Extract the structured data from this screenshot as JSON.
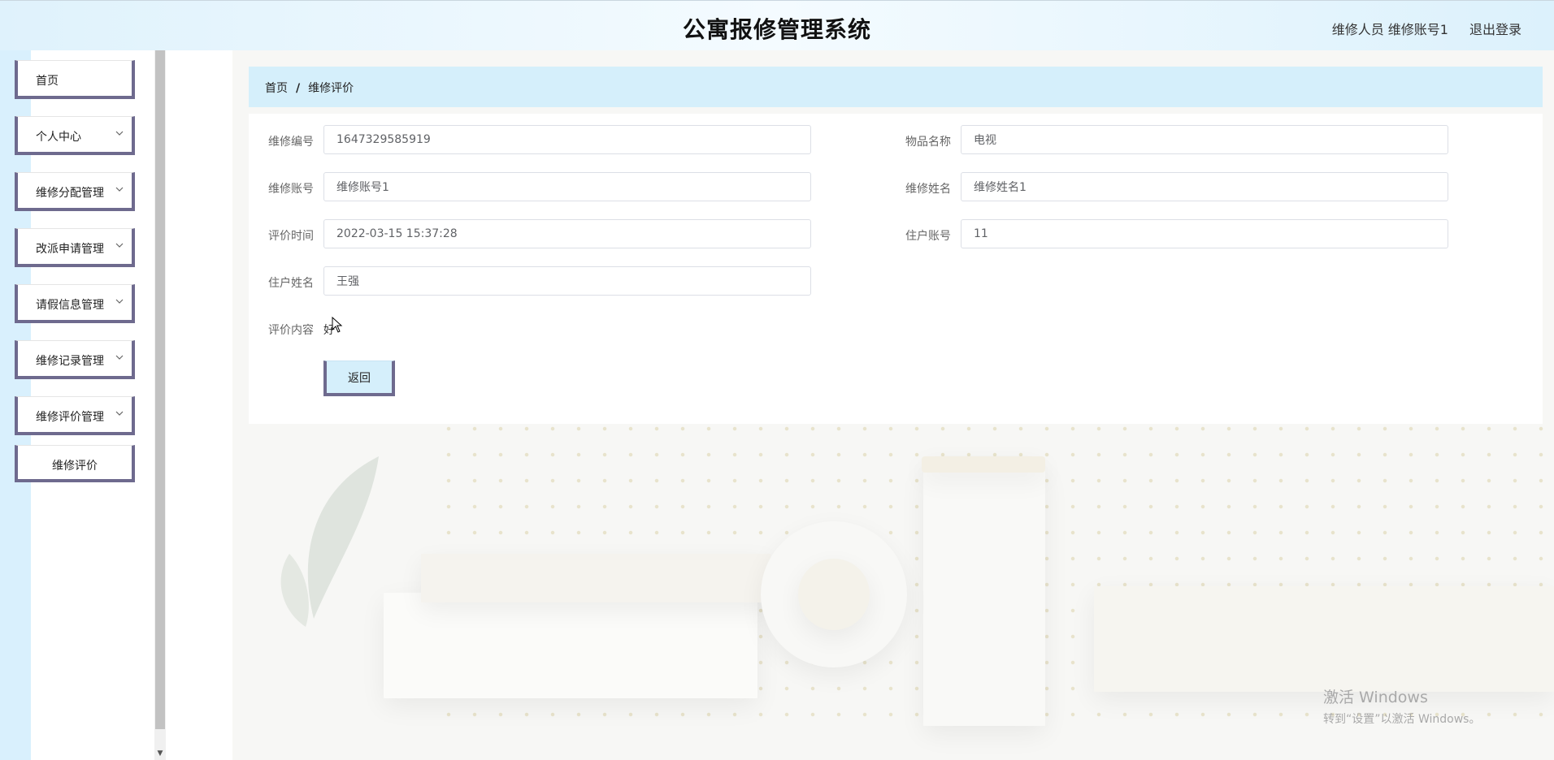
{
  "header": {
    "title": "公寓报修管理系统",
    "user": "维修人员 维修账号1",
    "logout": "退出登录"
  },
  "sidebar": {
    "items": [
      {
        "label": "首页",
        "has_chevron": false
      },
      {
        "label": "个人中心",
        "has_chevron": true
      },
      {
        "label": "维修分配管理",
        "has_chevron": true
      },
      {
        "label": "改派申请管理",
        "has_chevron": true
      },
      {
        "label": "请假信息管理",
        "has_chevron": true
      },
      {
        "label": "维修记录管理",
        "has_chevron": true
      },
      {
        "label": "维修评价管理",
        "has_chevron": true
      }
    ],
    "sub_item": "维修评价"
  },
  "breadcrumb": {
    "home": "首页",
    "separator": "/",
    "current": "维修评价"
  },
  "form": {
    "repair_no": {
      "label": "维修编号",
      "value": "1647329585919"
    },
    "item_name": {
      "label": "物品名称",
      "value": "电视"
    },
    "repair_account": {
      "label": "维修账号",
      "value": "维修账号1"
    },
    "repair_name": {
      "label": "维修姓名",
      "value": "维修姓名1"
    },
    "eval_time": {
      "label": "评价时间",
      "value": "2022-03-15 15:37:28"
    },
    "resident_account": {
      "label": "住户账号",
      "value": "11"
    },
    "resident_name": {
      "label": "住户姓名",
      "value": "王强"
    },
    "eval_content": {
      "label": "评价内容",
      "value": "好"
    }
  },
  "buttons": {
    "back": "返回"
  },
  "watermark": {
    "line1": "激活 Windows",
    "line2": "转到“设置”以激活 Windows。"
  },
  "colors": {
    "accent_light_blue": "#d5effb",
    "menu_border": "#6e6a8e"
  }
}
